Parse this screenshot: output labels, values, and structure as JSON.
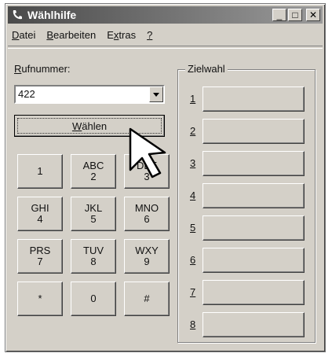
{
  "window": {
    "title": "Wählhilfe"
  },
  "titlebar_buttons": {
    "minimize": "_",
    "maximize": "□",
    "close": "✕"
  },
  "menu": [
    {
      "accel": "D",
      "rest": "atei"
    },
    {
      "accel": "B",
      "rest": "earbeiten"
    },
    {
      "accel": "",
      "pre": "E",
      "accel2": "x",
      "rest": "tras"
    },
    {
      "accel": "?",
      "rest": ""
    }
  ],
  "menu_text": [
    "Datei",
    "Bearbeiten",
    "Extras",
    "?"
  ],
  "number_label": {
    "accel": "R",
    "rest": "ufnummer:"
  },
  "number_value": "422",
  "dial_button": {
    "pre": "",
    "accel": "W",
    "rest": "ählen"
  },
  "keypad": [
    {
      "top": "",
      "bottom": "1"
    },
    {
      "top": "ABC",
      "bottom": "2"
    },
    {
      "top": "DEF",
      "bottom": "3"
    },
    {
      "top": "GHI",
      "bottom": "4"
    },
    {
      "top": "JKL",
      "bottom": "5"
    },
    {
      "top": "MNO",
      "bottom": "6"
    },
    {
      "top": "PRS",
      "bottom": "7"
    },
    {
      "top": "TUV",
      "bottom": "8"
    },
    {
      "top": "WXY",
      "bottom": "9"
    },
    {
      "top": "",
      "bottom": "*"
    },
    {
      "top": "",
      "bottom": "0"
    },
    {
      "top": "",
      "bottom": "#"
    }
  ],
  "speed_dial": {
    "title": "Zielwahl",
    "slots": [
      "1",
      "2",
      "3",
      "4",
      "5",
      "6",
      "7",
      "8"
    ]
  },
  "icons": {
    "app": "phone-icon",
    "dropdown": "chevron-down-icon",
    "cursor": "mouse-pointer-icon"
  }
}
